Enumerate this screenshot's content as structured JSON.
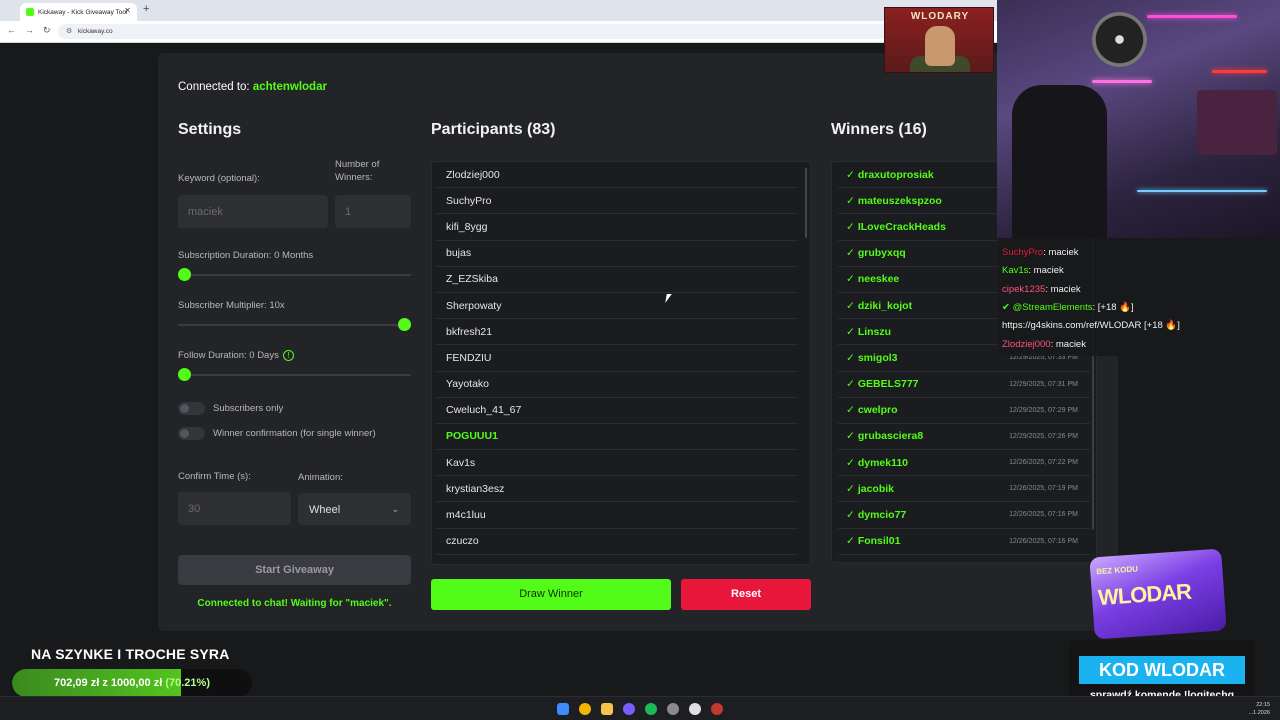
{
  "browser": {
    "tab_title": "Kickaway - Kick Giveaway Tool",
    "url": "kickaway.co"
  },
  "app": {
    "connected_label": "Connected to:",
    "channel": "achtenwlodar",
    "settings": {
      "title": "Settings",
      "keyword_label": "Keyword (optional):",
      "keyword_value": "maciek",
      "winners_label": "Number of Winners:",
      "winners_value": "1",
      "sub_duration_label": "Subscription Duration: 0 Months",
      "sub_duration_level": 0,
      "sub_multiplier_label": "Subscriber Multiplier: 10x",
      "sub_multiplier_level": 1,
      "follow_duration_label": "Follow Duration: 0 Days",
      "follow_duration_level": 0,
      "subscribers_only_label": "Subscribers only",
      "winner_confirmation_label": "Winner confirmation (for single winner)",
      "confirm_time_label": "Confirm Time (s):",
      "confirm_time_value": "30",
      "animation_label": "Animation:",
      "animation_value": "Wheel",
      "start_button": "Start Giveaway",
      "status": "Connected to chat! Waiting for \"maciek\"."
    },
    "participants": {
      "title": "Participants (83)",
      "items": [
        "Zlodziej000",
        "SuchyPro",
        "kifi_8ygg",
        "bujas",
        "Z_EZSkiba",
        "Sherpowaty",
        "bkfresh21",
        "FENDZIU",
        "Yayotako",
        "Cweluch_41_67",
        "POGUUU1",
        "Kav1s",
        "krystian3esz",
        "m4c1luu",
        "czuczo"
      ],
      "highlighted": "POGUUU1"
    },
    "draw_button": "Draw Winner",
    "reset_button": "Reset",
    "winners": {
      "title": "Winners (16)",
      "items": [
        {
          "name": "draxutoprosiak",
          "time": ""
        },
        {
          "name": "mateuszekspzoo",
          "time": ""
        },
        {
          "name": "ILoveCrackHeads",
          "time": ""
        },
        {
          "name": "grubyxqq",
          "time": ""
        },
        {
          "name": "neeskee",
          "time": ""
        },
        {
          "name": "dziki_kojot",
          "time": ""
        },
        {
          "name": "Linszu",
          "time": ""
        },
        {
          "name": "smigol3",
          "time": "12/29/2025, 07:33 PM"
        },
        {
          "name": "GEBELS777",
          "time": "12/29/2025, 07:31 PM"
        },
        {
          "name": "cwelpro",
          "time": "12/29/2025, 07:29 PM"
        },
        {
          "name": "grubasciera8",
          "time": "12/29/2025, 07:26 PM"
        },
        {
          "name": "dymek110",
          "time": "12/26/2025, 07:22 PM"
        },
        {
          "name": "jacobik",
          "time": "12/26/2025, 07:19 PM"
        },
        {
          "name": "dymcio77",
          "time": "12/26/2025, 07:16 PM"
        },
        {
          "name": "Fonsil01",
          "time": "12/26/2025, 07:16 PM"
        }
      ]
    }
  },
  "stream": {
    "banner_text": "WLODARY",
    "chat": [
      {
        "user": "SuchyPro",
        "msg": ": maciek",
        "color": "#e8163a"
      },
      {
        "user": "Kav1s",
        "msg": ": maciek",
        "color": "#53fc18"
      },
      {
        "user": "cipek1235",
        "msg": ": maciek",
        "color": "#ff4f7a"
      },
      {
        "user": "@StreamElements",
        "msg": ": [+18 🔥]",
        "color": "#53fc18"
      },
      {
        "user": "",
        "msg": "https://g4skins.com/ref/WLODAR [+18 🔥]",
        "color": "#f1f1f1"
      },
      {
        "user": "Zlodziej000",
        "msg": ": maciek",
        "color": "#ff4f7a"
      }
    ],
    "promo_small": "BEZ KODU",
    "promo_big": "WLODAR",
    "kod_title": "KOD WLODAR",
    "kod_sub": "sprawdź komendę !logitechg",
    "goal_title": "NA SZYNKE I TROCHE SYRA",
    "goal_current": "702,09 zł",
    "goal_sep": "z",
    "goal_target": "1000,00 zł",
    "goal_pct": "(70.21%)",
    "goal_fraction": 0.7021,
    "clock_time": "22:15",
    "clock_date": "...1.2026"
  }
}
